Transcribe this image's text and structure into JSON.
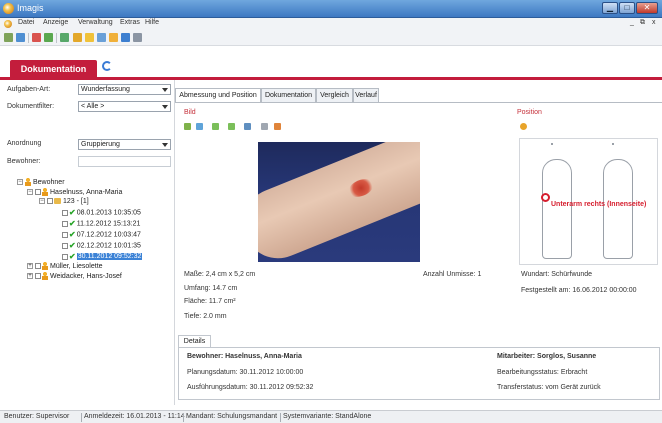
{
  "window": {
    "title": "Imagis",
    "btn_minimize": "▁",
    "btn_maximize": "□",
    "btn_close": "✕"
  },
  "menu": [
    "Datei",
    "Anzeige",
    "Verwaltung",
    "Extras",
    "Hilfe"
  ],
  "menu_right": {
    "minimize": "_",
    "restore": "⧉",
    "close": "x"
  },
  "module": {
    "label": "Dokumentation"
  },
  "filters": {
    "aufgaben_label": "Aufgaben-Art:",
    "aufgaben_value": "Wunderfassung",
    "dokfilter_label": "Dokumentfilter:",
    "dokfilter_value": "< Alle >",
    "anordnung_label": "Anordnung",
    "anordnung_value": "Gruppierung",
    "bewohner_label": "Bewohner:",
    "bewohner_value": ""
  },
  "tree": {
    "root": "Bewohner",
    "person1": "Haselnuss, Anna-Maria",
    "group1": "123 - [1]",
    "entries": [
      "08.01.2013 10:35:05",
      "11.12.2012 15:13:21",
      "07.12.2012 10:03:47",
      "02.12.2012 10:01:35",
      "30.11.2012 09:52:32"
    ],
    "person2": "Müller, Liesolette",
    "person3": "Weidacker, Hans-Josef"
  },
  "tabs": [
    "Abmessung und Position",
    "Dokumentation",
    "Vergleich",
    "Verlauf"
  ],
  "bild": {
    "title": "Bild"
  },
  "position": {
    "title": "Position",
    "marker_label": "Unterarm rechts (Innenseite)",
    "wundart": "Wundart: Schürfwunde",
    "festgestellt": "Festgestellt am: 16.06.2012 00:00:00"
  },
  "measurements": {
    "masse": "Maße: 2,4 cm x 5,2 cm",
    "anzahl": "Anzahl Unmisse: 1",
    "umfang": "Umfang: 14.7 cm",
    "flaeche": "Fläche: 11.7 cm²",
    "tiefe": "Tiefe: 2.0 mm"
  },
  "details": {
    "tab": "Details",
    "bewohner": "Bewohner: Haselnuss, Anna-Maria",
    "planung": "Planungsdatum: 30.11.2012 10:00:00",
    "ausfuehrung": "Ausführungsdatum: 30.11.2012 09:52:32",
    "mitarbeiter": "Mitarbeiter: Sorglos, Susanne",
    "bearbeitung": "Bearbeitungsstatus: Erbracht",
    "transfer": "Transferstatus: vom Gerät zurück"
  },
  "status": {
    "benutzer": "Benutzer: Supervisor",
    "anmelde": "Anmeldezeit: 16.01.2013 - 11:14",
    "mandant": "Mandant: Schulungsmandant",
    "system": "Systemvariante: StandAlone"
  },
  "colors": {
    "accent": "#c31d3c",
    "title_blue": "#3d78c2",
    "marker_red": "#d61e2e",
    "tree_selection": "#3b82d6"
  }
}
